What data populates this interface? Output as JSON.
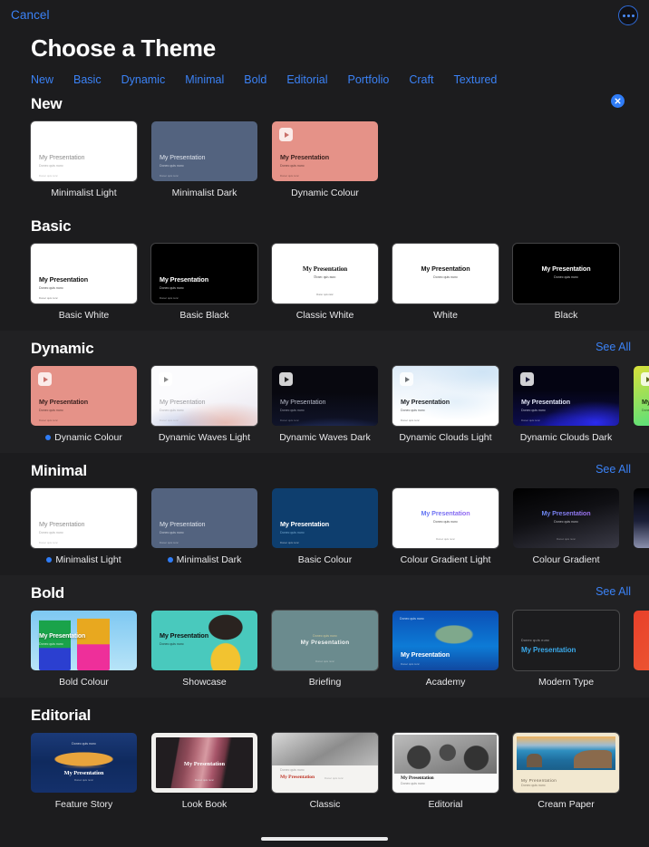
{
  "topbar": {
    "cancel_label": "Cancel",
    "more_icon": "ellipsis-icon"
  },
  "header": {
    "title": "Choose a Theme",
    "categories": [
      "New",
      "Basic",
      "Dynamic",
      "Minimal",
      "Bold",
      "Editorial",
      "Portfolio",
      "Craft",
      "Textured"
    ]
  },
  "common": {
    "see_all_label": "See All",
    "slide_title": "My Presentation",
    "slide_subtitle": "Donec quis nunc",
    "slide_footer": "Donec quis nunc"
  },
  "sections": [
    {
      "title": "New",
      "has_close": true,
      "has_see_all": false,
      "themes": [
        {
          "name": "Minimalist Light",
          "selected": false
        },
        {
          "name": "Minimalist Dark",
          "selected": false
        },
        {
          "name": "Dynamic Colour",
          "selected": false
        }
      ]
    },
    {
      "title": "Basic",
      "has_close": false,
      "has_see_all": false,
      "themes": [
        {
          "name": "Basic White",
          "selected": false
        },
        {
          "name": "Basic Black",
          "selected": false
        },
        {
          "name": "Classic White",
          "selected": false
        },
        {
          "name": "White",
          "selected": false
        },
        {
          "name": "Black",
          "selected": false
        }
      ]
    },
    {
      "title": "Dynamic",
      "has_close": false,
      "has_see_all": true,
      "themes": [
        {
          "name": "Dynamic Colour",
          "selected": true
        },
        {
          "name": "Dynamic Waves Light",
          "selected": false
        },
        {
          "name": "Dynamic Waves Dark",
          "selected": false
        },
        {
          "name": "Dynamic Clouds Light",
          "selected": false
        },
        {
          "name": "Dynamic Clouds Dark",
          "selected": false
        },
        {
          "name": "",
          "selected": false
        }
      ]
    },
    {
      "title": "Minimal",
      "has_close": false,
      "has_see_all": true,
      "themes": [
        {
          "name": "Minimalist Light",
          "selected": true
        },
        {
          "name": "Minimalist Dark",
          "selected": true
        },
        {
          "name": "Basic Colour",
          "selected": false
        },
        {
          "name": "Colour Gradient Light",
          "selected": false
        },
        {
          "name": "Colour Gradient",
          "selected": false
        },
        {
          "name": "",
          "selected": false
        }
      ]
    },
    {
      "title": "Bold",
      "has_close": false,
      "has_see_all": true,
      "themes": [
        {
          "name": "Bold Colour",
          "selected": false
        },
        {
          "name": "Showcase",
          "selected": false
        },
        {
          "name": "Briefing",
          "selected": false
        },
        {
          "name": "Academy",
          "selected": false
        },
        {
          "name": "Modern Type",
          "selected": false
        },
        {
          "name": "",
          "selected": false
        }
      ]
    },
    {
      "title": "Editorial",
      "has_close": false,
      "has_see_all": false,
      "themes": [
        {
          "name": "Feature Story",
          "selected": false
        },
        {
          "name": "Look Book",
          "selected": false
        },
        {
          "name": "Classic",
          "selected": false
        },
        {
          "name": "Editorial",
          "selected": false
        },
        {
          "name": "Cream Paper",
          "selected": false
        }
      ]
    }
  ],
  "colors": {
    "accent": "#3b82f6",
    "background": "#1c1c1e",
    "section_alt": "#212123",
    "dynamic_colour": "#e59288",
    "minimalist_dark": "#53637f",
    "basic_colour": "#0e3e6e"
  }
}
